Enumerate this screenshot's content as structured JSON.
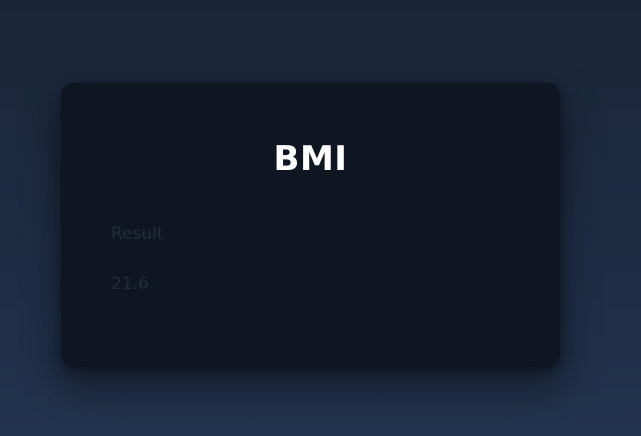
{
  "card": {
    "title": "BMI",
    "result_label": "Result",
    "result_value": "21.6"
  },
  "colors": {
    "background_top": "#1a2638",
    "background_bottom": "#22334d",
    "card_background": "#0f1622",
    "title_text": "#ffffff",
    "muted_text": "#222d3c"
  }
}
